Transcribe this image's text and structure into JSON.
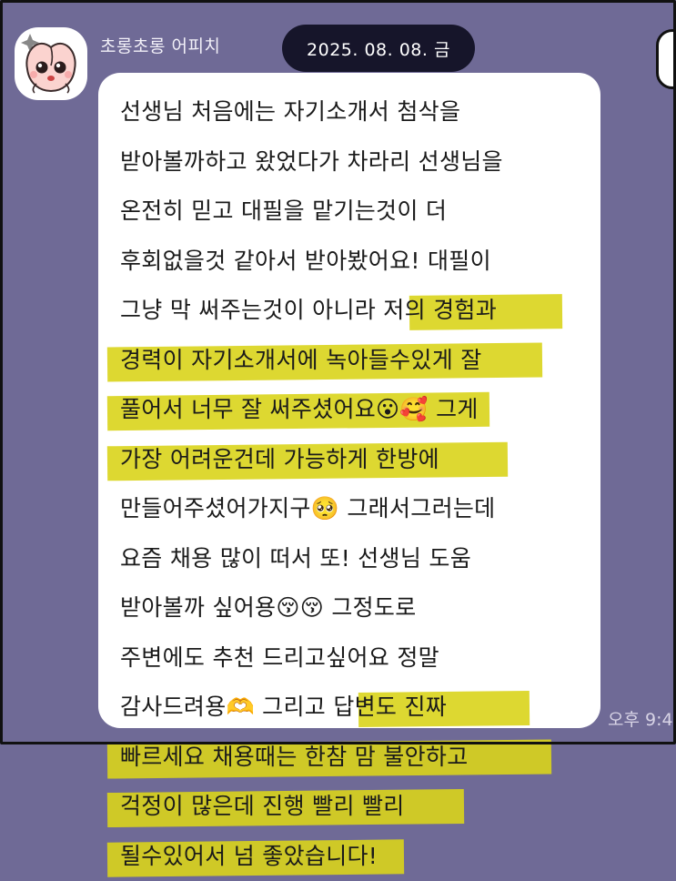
{
  "header": {
    "sender_name": "초롱초롱 어피치",
    "date": "2025. 08. 08. 금"
  },
  "avatar": {
    "icon": "apeach-character-icon",
    "alt": "어피치"
  },
  "message": {
    "lines": [
      "선생님 처음에는 자기소개서 첨삭을",
      "받아볼까하고 왔었다가 차라리 선생님을",
      "온전히 믿고 대필을 맡기는것이 더",
      "후회없을것 같아서 받아봤어요! 대필이",
      "그냥 막 써주는것이 아니라 저의 경험과",
      "경력이 자기소개서에 녹아들수있게 잘",
      "풀어서 너무 잘 써주셨어요😮🥰 그게",
      "가장 어려운건데 가능하게 한방에",
      "만들어주셨어가지구🥺 그래서그러는데",
      "요즘 채용 많이 떠서 또! 선생님 도움",
      "받아볼까 싶어용😚😚 그정도로",
      "주변에도 추천 드리고싶어요 정말",
      "감사드려용🫶 그리고 답변도 진짜",
      "빠르세요 채용때는 한참 맘 불안하고",
      "걱정이 많은데 진행 빨리 빨리",
      "될수있어서 넘 좋았습니다!"
    ],
    "time": "오후 9:4"
  },
  "colors": {
    "background": "#6f6a96",
    "bubble": "#ffffff",
    "highlight": "#d9d41b",
    "date_pill": "#16152a"
  }
}
